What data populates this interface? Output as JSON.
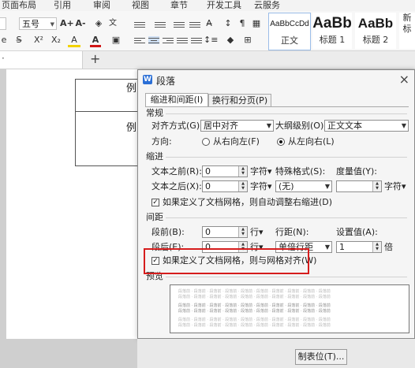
{
  "menubar": {
    "items": [
      "页面布局",
      "引用",
      "审阅",
      "视图",
      "章节",
      "开发工具",
      "云服务"
    ]
  },
  "ribbon": {
    "font_size": "五号",
    "grow_font": "A+",
    "shrink_font": "A-",
    "superscript": "X²",
    "subscript": "X₂",
    "highlight_label": "A",
    "font_color_label": "A",
    "styles": [
      {
        "sample": "AaBbCcDd",
        "name": "正文"
      },
      {
        "sample": "AaBb",
        "name": "标题 1"
      },
      {
        "sample": "AaBb",
        "name": "标题 2"
      },
      {
        "sample": "",
        "name": "新标"
      }
    ],
    "new_tab": "+"
  },
  "document": {
    "cell_text_1": "例",
    "cell_text_2": "例"
  },
  "dialog": {
    "title": "段落",
    "close": "×",
    "tabs": [
      "缩进和间距(I)",
      "换行和分页(P)"
    ],
    "general": {
      "heading": "常规",
      "alignment_label": "对齐方式(G):",
      "alignment_value": "居中对齐",
      "outline_label": "大纲级别(O):",
      "outline_value": "正文文本",
      "direction_label": "方向:",
      "rtl_label": "从右向左(F)",
      "ltr_label": "从左向右(L)"
    },
    "indent": {
      "heading": "缩进",
      "before_label": "文本之前(R):",
      "before_value": "0",
      "after_label": "文本之后(X):",
      "after_value": "0",
      "unit": "字符▾",
      "special_label": "特殊格式(S):",
      "special_value": "(无)",
      "measure_label": "度量值(Y):",
      "measure_value": "",
      "measure_unit": "字符▾",
      "auto_adjust_label": "如果定义了文档网格，则自动调整右缩进(D)"
    },
    "spacing": {
      "heading": "间距",
      "before_label": "段前(B):",
      "before_value": "0",
      "after_label": "段后(E):",
      "after_value": "0",
      "unit": "行▾",
      "line_label": "行距(N):",
      "line_value": "单倍行距",
      "setting_label": "设置值(A):",
      "setting_value": "1",
      "setting_unit": "倍",
      "snap_grid_label": "如果定义了文档网格，则与网格对齐(W)"
    },
    "preview": {
      "heading": "预览",
      "sample_line": "段落前 · 段落前 · 段落前 · 段落前 · 段落前 · 段落前 · 段落前 · 段落前 · 段落前 · 段落前"
    },
    "tabstops_button": "制表位(T)..."
  }
}
